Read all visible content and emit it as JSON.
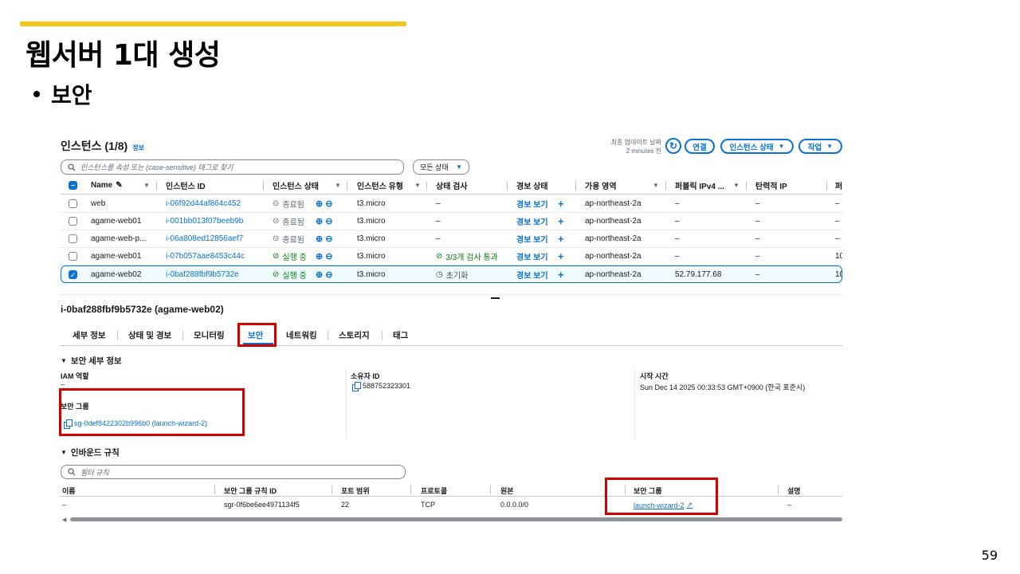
{
  "slide": {
    "title": "웹서버 1대 생성",
    "bullet": "보안",
    "page_number": "59"
  },
  "console": {
    "header": {
      "title": "인스턴스 (1/8)",
      "info": "정보",
      "updated_label": "최종 업데이트 날짜",
      "updated_value": "2 minutes 전",
      "connect": "연결",
      "instance_state": "인스턴스 상태",
      "actions": "작업"
    },
    "search": {
      "placeholder": "인스턴스를 속성 또는 (case-sensitive) 태그로 찾기"
    },
    "state_filter": "모든 상태",
    "columns": [
      "Name",
      "인스턴스 ID",
      "인스턴스 상태",
      "인스턴스 유형",
      "상태 검사",
      "경보 상태",
      "가용 영역",
      "퍼블릭 IPv4 ...",
      "탄력적 IP",
      "퍼"
    ],
    "rows": [
      {
        "name": "web",
        "id": "i-06f92d44af864c452",
        "state": "종료됨",
        "type": "t3.micro",
        "check": "–",
        "alarm": "경보 보기",
        "az": "ap-northeast-2a",
        "ipv4": "–",
        "eip": "–",
        "extra": "–"
      },
      {
        "name": "agame-web01",
        "id": "i-001bb013f07beeb9b",
        "state": "종료됨",
        "type": "t3.micro",
        "check": "–",
        "alarm": "경보 보기",
        "az": "ap-northeast-2a",
        "ipv4": "–",
        "eip": "–",
        "extra": "–"
      },
      {
        "name": "agame-web-p...",
        "id": "i-06a808ed12856aef7",
        "state": "종료됨",
        "type": "t3.micro",
        "check": "–",
        "alarm": "경보 보기",
        "az": "ap-northeast-2a",
        "ipv4": "–",
        "eip": "–",
        "extra": "–"
      },
      {
        "name": "agame-web01",
        "id": "i-07b057aae8453c44c",
        "state": "실행 중",
        "type": "t3.micro",
        "check": "3/3개 검사 통과",
        "alarm": "경보 보기",
        "az": "ap-northeast-2a",
        "ipv4": "–",
        "eip": "–",
        "extra": "10"
      },
      {
        "name": "agame-web02",
        "id": "i-0baf288fbf9b5732e",
        "state": "실행 중",
        "type": "t3.micro",
        "check": "초기화",
        "alarm": "경보 보기",
        "az": "ap-northeast-2a",
        "ipv4": "52.79.177.68",
        "eip": "–",
        "extra": "10"
      }
    ],
    "detail": {
      "title": "i-0baf288fbf9b5732e (agame-web02)",
      "tabs": [
        "세부 정보",
        "상태 및 경보",
        "모니터링",
        "보안",
        "네트워킹",
        "스토리지",
        "태그"
      ],
      "active_tab": "보안",
      "security_section": "보안 세부 정보",
      "iam_role_label": "IAM 역할",
      "iam_role_value": "–",
      "owner_label": "소유자 ID",
      "owner_value": "588752323301",
      "launch_label": "시작 시간",
      "launch_value": "Sun Dec 14 2025 00:33:53 GMT+0900 (한국 표준시)",
      "sg_label": "보안 그룹",
      "sg_value": "sg-0def8422302b996b0 (launch-wizard-2)"
    },
    "inbound": {
      "section": "인바운드 규칙",
      "filter_placeholder": "필터 규칙",
      "columns": [
        "이름",
        "보안 그룹 규칙 ID",
        "포트 범위",
        "프로토콜",
        "원본",
        "보안 그룹",
        "설명"
      ],
      "rows": [
        {
          "name": "–",
          "rule_id": "sgr-0f6be6ee4971134f5",
          "port": "22",
          "protocol": "TCP",
          "source": "0.0.0.0/0",
          "sg": "launch-wizard-2",
          "desc": "–"
        }
      ]
    }
  },
  "colors": {
    "accent_bar": "#f5c518",
    "link": "#0972d3",
    "running": "#037f0c",
    "highlight": "#d10000"
  },
  "icons": [
    "refresh-icon",
    "search-icon",
    "edit-icon",
    "stop-circle-icon",
    "check-circle-icon",
    "clock-icon",
    "zoom-icon",
    "plus-icon",
    "copy-icon",
    "external-link-icon"
  ]
}
